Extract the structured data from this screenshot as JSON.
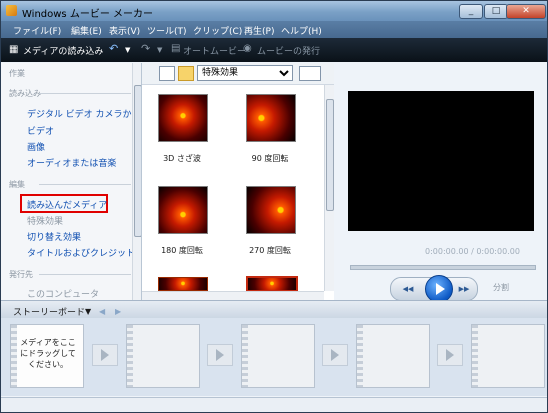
{
  "window": {
    "title": "Windows ムービー メーカー",
    "min": "_",
    "max": "□",
    "close": "✕"
  },
  "menu": [
    "ファイル(F)",
    "編集(E)",
    "表示(V)",
    "ツール(T)",
    "クリップ(C)",
    "再生(P)",
    "ヘルプ(H)"
  ],
  "toolbar": {
    "import_media": "メディアの読み込み",
    "auto_movie": "オートムービー",
    "publish": "ムービーの発行"
  },
  "tasks": {
    "header": "作業",
    "import_section": "読み込み",
    "import_links": [
      "デジタル ビデオ カメラから",
      "ビデオ",
      "画像",
      "オーディオまたは音楽"
    ],
    "edit_section": "編集",
    "edit_links": [
      "読み込んだメディア",
      "特殊効果",
      "切り替え効果",
      "タイトルおよびクレジット"
    ],
    "publish_section": "発行先",
    "publish_links": [
      "このコンピュータ"
    ]
  },
  "collection": {
    "dropdown": "特殊効果",
    "items": [
      {
        "label": "3D さざ波"
      },
      {
        "label": "90 度回転"
      },
      {
        "label": "180 度回転"
      },
      {
        "label": "270 度回転"
      }
    ]
  },
  "preview": {
    "time": "0:00:00.00 / 0:00:00.00",
    "split": "分割"
  },
  "storyboard": {
    "label": "ストーリーボード",
    "drop_hint": "メディアをここにドラッグしてください。"
  }
}
